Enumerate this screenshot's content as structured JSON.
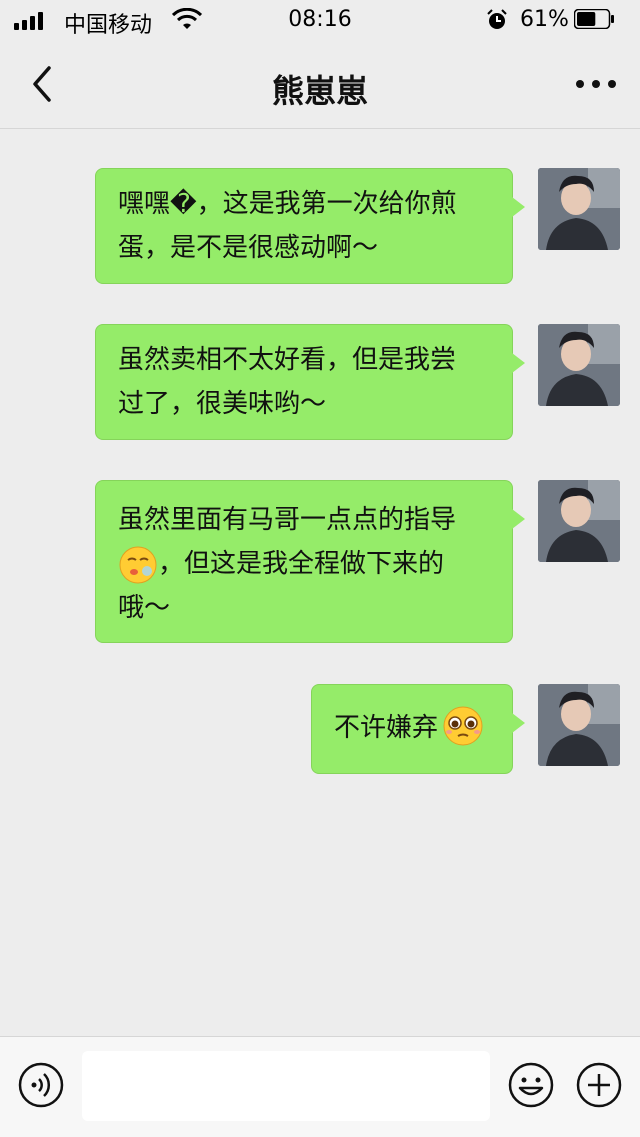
{
  "status_bar": {
    "carrier": "中国移动",
    "time": "08:16",
    "battery_percent": "61%",
    "battery_level": 0.61
  },
  "header": {
    "title": "熊崽崽",
    "back_icon": "chevron-left-icon",
    "more_icon": "more-icon"
  },
  "messages": [
    {
      "sender": "self",
      "lines": [
        "嘿嘿�，这是我第一次给你煎",
        "蛋，是不是很感动啊～"
      ]
    },
    {
      "sender": "self",
      "lines": [
        "虽然卖相不太好看，但是我尝",
        "过了，很美味哟～"
      ]
    },
    {
      "sender": "self",
      "lines": [
        "虽然里面有马哥一点点的指导",
        "，但这是我全程做下来的",
        "哦～"
      ],
      "emoji": "sleepy-face-emoji"
    },
    {
      "sender": "self",
      "lines": [
        "不许嫌弃"
      ],
      "emoji": "pleading-face-emoji"
    }
  ],
  "input_bar": {
    "voice_icon": "voice-icon",
    "text_value": "",
    "emoji_icon": "smiley-icon",
    "plus_icon": "plus-icon"
  },
  "colors": {
    "bubble": "#95ec69",
    "background": "#ededed"
  }
}
